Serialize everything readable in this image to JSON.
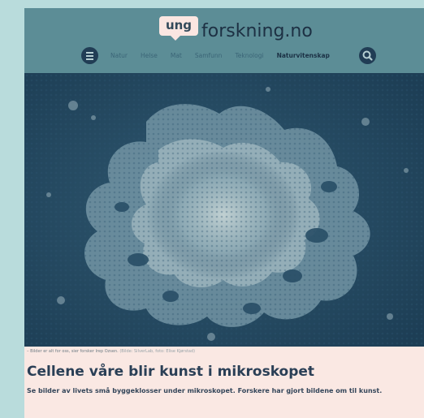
{
  "header": {
    "logo_badge": "ung",
    "site_name": "forskning.no",
    "nav": [
      "Natur",
      "Helse",
      "Mat",
      "Samfunn",
      "Teknologi",
      "Naturvitenskap"
    ],
    "active_nav_index": 5
  },
  "hero": {
    "caption": "– Bilder er alt for oss, sier forsker Irep Ozsen.",
    "credit": "(Bilde: SilverLab, foto: Elise Kjørstad)"
  },
  "article": {
    "headline": "Cellene våre blir kunst i mikroskopet",
    "lead": "Se bilder av livets små byggeklosser under mikroskopet. Forskere har gjort bildene om til kunst."
  },
  "colors": {
    "page_bg": "#b9dcdc",
    "header_bg": "#5c8d96",
    "content_bg": "#fae8e3",
    "headline": "#2a3f56"
  },
  "icons": {
    "menu": "hamburger-icon",
    "search": "search-icon"
  }
}
